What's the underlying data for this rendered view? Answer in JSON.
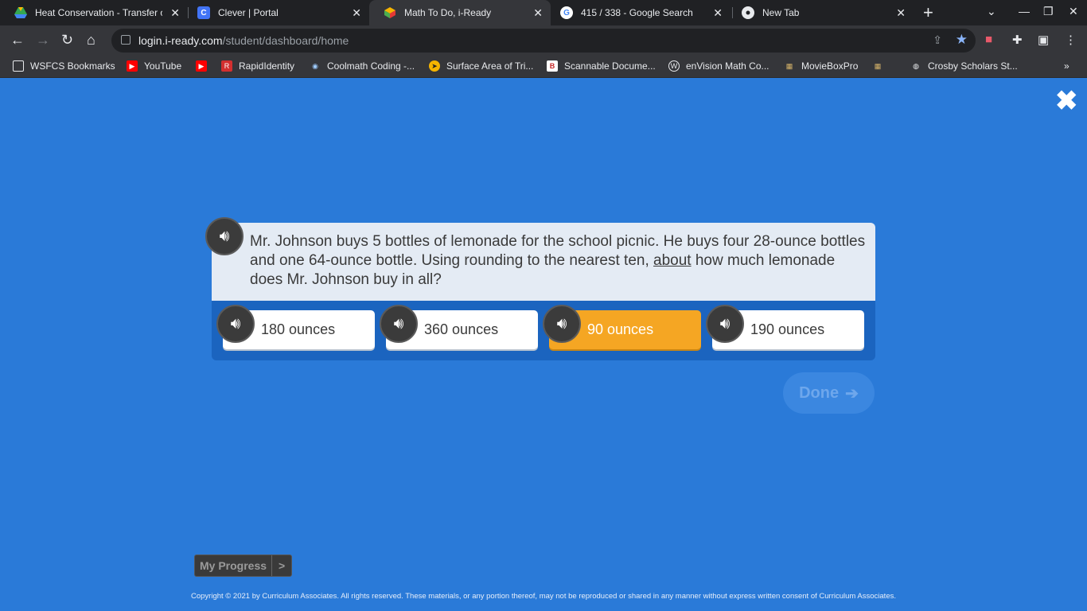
{
  "browser": {
    "tabs": [
      {
        "label": "Heat Conservation - Transfer of",
        "icon": "google-drive-icon",
        "active": false
      },
      {
        "label": "Clever | Portal",
        "icon": "clever-icon",
        "active": false
      },
      {
        "label": "Math To Do, i-Ready",
        "icon": "iready-icon",
        "active": true
      },
      {
        "label": "415 / 338 - Google Search",
        "icon": "google-icon",
        "active": false
      },
      {
        "label": "New Tab",
        "icon": "chrome-icon",
        "active": false
      }
    ],
    "url_host": "login.i-ready.com",
    "url_path": "/student/dashboard/home",
    "bookmarks": [
      {
        "label": "WSFCS Bookmarks",
        "icon": "folder-icon"
      },
      {
        "label": "YouTube",
        "icon": "youtube-icon"
      },
      {
        "label": "",
        "icon": "youtube-icon"
      },
      {
        "label": "RapidIdentity",
        "icon": "rapididentity-icon"
      },
      {
        "label": "Coolmath Coding -...",
        "icon": "coolmath-icon"
      },
      {
        "label": "Surface Area of Tri...",
        "icon": "bookmark-icon"
      },
      {
        "label": "Scannable Docume...",
        "icon": "bookmark-icon"
      },
      {
        "label": "enVision Math Co...",
        "icon": "wordpress-icon"
      },
      {
        "label": "MovieBoxPro",
        "icon": "movie-icon"
      },
      {
        "label": "",
        "icon": "movie-icon"
      },
      {
        "label": "Crosby Scholars St...",
        "icon": "globe-icon"
      }
    ]
  },
  "question": {
    "text_before": "Mr. Johnson buys 5 bottles of lemonade for the school picnic. He buys four 28-ounce bottles and one 64-ounce bottle. Using rounding to the nearest ten, ",
    "text_underlined": "about",
    "text_after": " how much lemonade does Mr. Johnson buy in all?"
  },
  "answers": [
    {
      "label": "180 ounces",
      "selected": false
    },
    {
      "label": "360 ounces",
      "selected": false
    },
    {
      "label": "90 ounces",
      "selected": true
    },
    {
      "label": "190 ounces",
      "selected": false
    }
  ],
  "done_label": "Done",
  "my_progress_label": "My Progress",
  "my_progress_arrow": ">",
  "copyright": "Copyright © 2021 by Curriculum Associates. All rights reserved. These materials, or any portion thereof, may not be reproduced or shared in any manner without express written consent of Curriculum Associates.",
  "colors": {
    "page_background": "#2a7ad8",
    "selected_answer": "#f5a623",
    "question_card": "#e4ebf4"
  }
}
